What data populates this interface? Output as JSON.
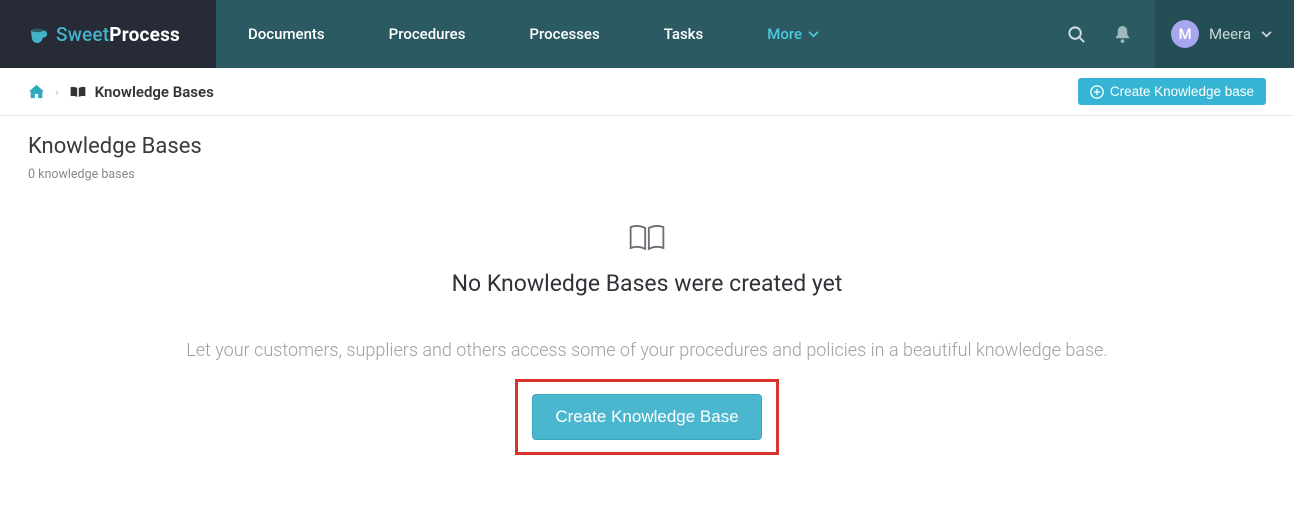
{
  "brand": {
    "light": "Sweet",
    "bold": "Process"
  },
  "nav": {
    "items": [
      "Documents",
      "Procedures",
      "Processes",
      "Tasks"
    ],
    "more": "More"
  },
  "user": {
    "initial": "M",
    "name": "Meera"
  },
  "breadcrumb": {
    "current": "Knowledge Bases"
  },
  "actions": {
    "create_small": "Create Knowledge base",
    "create_big": "Create Knowledge Base"
  },
  "page": {
    "title": "Knowledge Bases",
    "subtitle": "0 knowledge bases"
  },
  "empty": {
    "title": "No Knowledge Bases were created yet",
    "desc": "Let your customers, suppliers and others access some of your procedures and policies in a beautiful knowledge base."
  }
}
